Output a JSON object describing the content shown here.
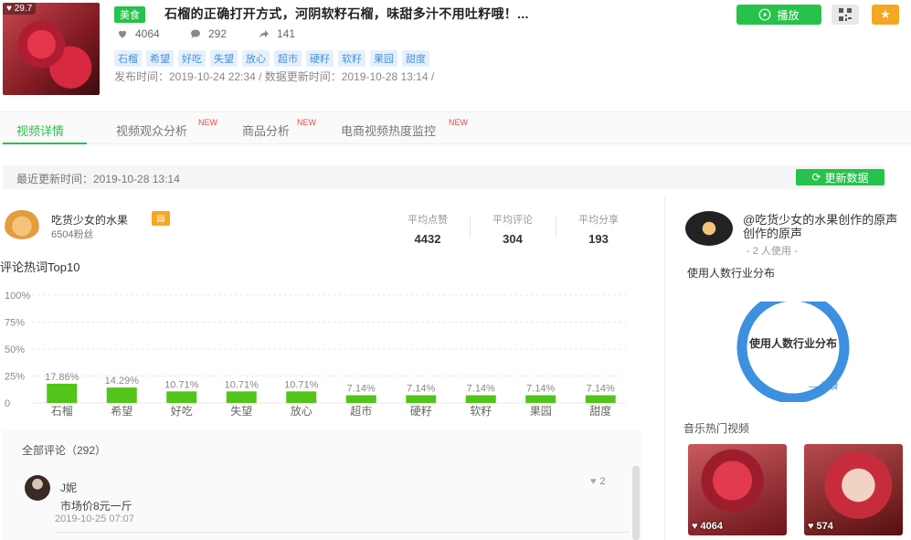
{
  "video": {
    "thumb_likes": "29.7",
    "category": "美食",
    "title": "石榴的正确打开方式，河阴软籽石榴，味甜多汁不用吐籽哦！...",
    "likes": "4064",
    "comments": "292",
    "shares": "141",
    "tags": [
      "石榴",
      "希望",
      "好吃",
      "失望",
      "放心",
      "超市",
      "硬籽",
      "软籽",
      "果园",
      "甜度"
    ],
    "meta": "发布时间：2019-10-24 22:34 / 数据更新时间：2019-10-28 13:14 /"
  },
  "actions": {
    "play_label": "播放"
  },
  "tabs": [
    {
      "label": "视频详情",
      "new": ""
    },
    {
      "label": "视频观众分析",
      "new": "NEW"
    },
    {
      "label": "商品分析",
      "new": "NEW"
    },
    {
      "label": "电商视频热度监控",
      "new": "NEW"
    }
  ],
  "update": {
    "text": "最近更新时间：2019-10-28 13:14",
    "button": "更新数据"
  },
  "author": {
    "name": "吃货少女的水果",
    "fans": "6504粉丝",
    "avg": [
      {
        "label": "平均点赞",
        "value": "4432"
      },
      {
        "label": "平均评论",
        "value": "304"
      },
      {
        "label": "平均分享",
        "value": "193"
      }
    ]
  },
  "chart_title": "评论热词Top10",
  "chart_data": {
    "type": "bar",
    "categories": [
      "石榴",
      "希望",
      "好吃",
      "失望",
      "放心",
      "超市",
      "硬籽",
      "软籽",
      "果园",
      "甜度"
    ],
    "values": [
      17.86,
      14.29,
      10.71,
      10.71,
      10.71,
      7.14,
      7.14,
      7.14,
      7.14,
      7.14
    ],
    "value_labels": [
      "17.86%",
      "14.29%",
      "10.71%",
      "10.71%",
      "10.71%",
      "7.14%",
      "7.14%",
      "7.14%",
      "7.14%",
      "7.14%"
    ],
    "ytick_labels": [
      "100%",
      "75%",
      "50%",
      "25%",
      "0"
    ],
    "ylim": [
      0,
      100
    ],
    "color": "#52c41a"
  },
  "comments": {
    "header": "全部评论（292）",
    "items": [
      {
        "user": "J妮",
        "text": "市场价8元一斤",
        "time": "2019-10-25 07:07",
        "likes": "2"
      }
    ]
  },
  "music": {
    "name": "@吃货少女的水果创作的原声　　创作的原声",
    "users": "- 2 人使用 -",
    "industry_title": "使用人数行业分布",
    "donut_label": "使用人数行业分布",
    "donut_legend": "美食",
    "donut_color": "#3d8fe0",
    "hot_title": "音乐热门视频",
    "videos": [
      {
        "likes": "4064"
      },
      {
        "likes": "574"
      }
    ]
  }
}
